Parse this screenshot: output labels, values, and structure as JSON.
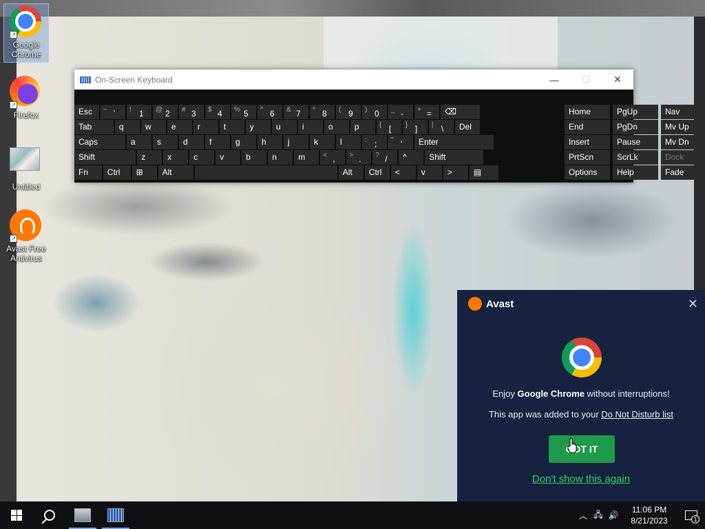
{
  "desktop": {
    "icons": [
      {
        "label": "Google\nChrome"
      },
      {
        "label": "Firefox"
      },
      {
        "label": "Untitled"
      },
      {
        "label": "Avast Free\nAntivirus"
      }
    ]
  },
  "osk": {
    "title": "On-Screen Keyboard",
    "window_buttons": {
      "minimize": "—",
      "maximize": "☐",
      "close": "✕"
    },
    "rows": [
      [
        {
          "p": "Esc"
        },
        {
          "s": "~",
          "p": "`"
        },
        {
          "s": "!",
          "p": "1"
        },
        {
          "s": "@",
          "p": "2"
        },
        {
          "s": "#",
          "p": "3"
        },
        {
          "s": "$",
          "p": "4"
        },
        {
          "s": "%",
          "p": "5"
        },
        {
          "s": "^",
          "p": "6"
        },
        {
          "s": "&",
          "p": "7"
        },
        {
          "s": "*",
          "p": "8"
        },
        {
          "s": "(",
          "p": "9"
        },
        {
          "s": ")",
          "p": "0"
        },
        {
          "s": "_",
          "p": "-"
        },
        {
          "s": "+",
          "p": "="
        },
        {
          "p": "⌫"
        },
        {
          "p": "Home"
        },
        {
          "p": "PgUp"
        },
        {
          "p": "Nav"
        }
      ],
      [
        {
          "p": "Tab"
        },
        {
          "p": "q"
        },
        {
          "p": "w"
        },
        {
          "p": "e"
        },
        {
          "p": "r"
        },
        {
          "p": "t"
        },
        {
          "p": "y"
        },
        {
          "p": "u"
        },
        {
          "p": "i"
        },
        {
          "p": "o"
        },
        {
          "p": "p"
        },
        {
          "s": "{",
          "p": "["
        },
        {
          "s": "}",
          "p": "]"
        },
        {
          "s": "|",
          "p": "\\"
        },
        {
          "p": "Del"
        },
        {
          "p": "End"
        },
        {
          "p": "PgDn"
        },
        {
          "p": "Mv Up"
        }
      ],
      [
        {
          "p": "Caps"
        },
        {
          "p": "a"
        },
        {
          "p": "s"
        },
        {
          "p": "d"
        },
        {
          "p": "f"
        },
        {
          "p": "g"
        },
        {
          "p": "h"
        },
        {
          "p": "j"
        },
        {
          "p": "k"
        },
        {
          "p": "l"
        },
        {
          "s": ":",
          "p": ";"
        },
        {
          "s": "\"",
          "p": "'"
        },
        {
          "p": "Enter"
        },
        {
          "p": "Insert"
        },
        {
          "p": "Pause"
        },
        {
          "p": "Mv Dn"
        }
      ],
      [
        {
          "p": "Shift"
        },
        {
          "p": "z"
        },
        {
          "p": "x"
        },
        {
          "p": "c"
        },
        {
          "p": "v"
        },
        {
          "p": "b"
        },
        {
          "p": "n"
        },
        {
          "p": "m"
        },
        {
          "s": "<",
          "p": ","
        },
        {
          "s": ">",
          "p": "."
        },
        {
          "s": "?",
          "p": "/"
        },
        {
          "p": "^"
        },
        {
          "p": "Shift"
        },
        {
          "p": "PrtScn"
        },
        {
          "p": "ScrLk"
        },
        {
          "p": "Dock"
        }
      ],
      [
        {
          "p": "Fn"
        },
        {
          "p": "Ctrl"
        },
        {
          "p": "⊞"
        },
        {
          "p": "Alt"
        },
        {
          "p": ""
        },
        {
          "p": "Alt"
        },
        {
          "p": "Ctrl"
        },
        {
          "p": "<"
        },
        {
          "p": "v"
        },
        {
          "p": ">"
        },
        {
          "p": "▤"
        },
        {
          "p": "Options"
        },
        {
          "p": "Help"
        },
        {
          "p": "Fade"
        }
      ]
    ]
  },
  "avast_popup": {
    "brand": "Avast",
    "close": "✕",
    "line1_pre": "Enjoy ",
    "line1_bold": "Google Chrome",
    "line1_post": " without interruptions!",
    "line2_pre": "This app was added to your ",
    "line2_link": "Do Not Disturb list",
    "button": "GOT IT",
    "dismiss": "Don't show this again"
  },
  "taskbar": {
    "tray_up": "︿",
    "tray_network": "🖧",
    "tray_volume": "🔊",
    "time": "11:06 PM",
    "date": "8/21/2023",
    "notification_count": "1"
  }
}
